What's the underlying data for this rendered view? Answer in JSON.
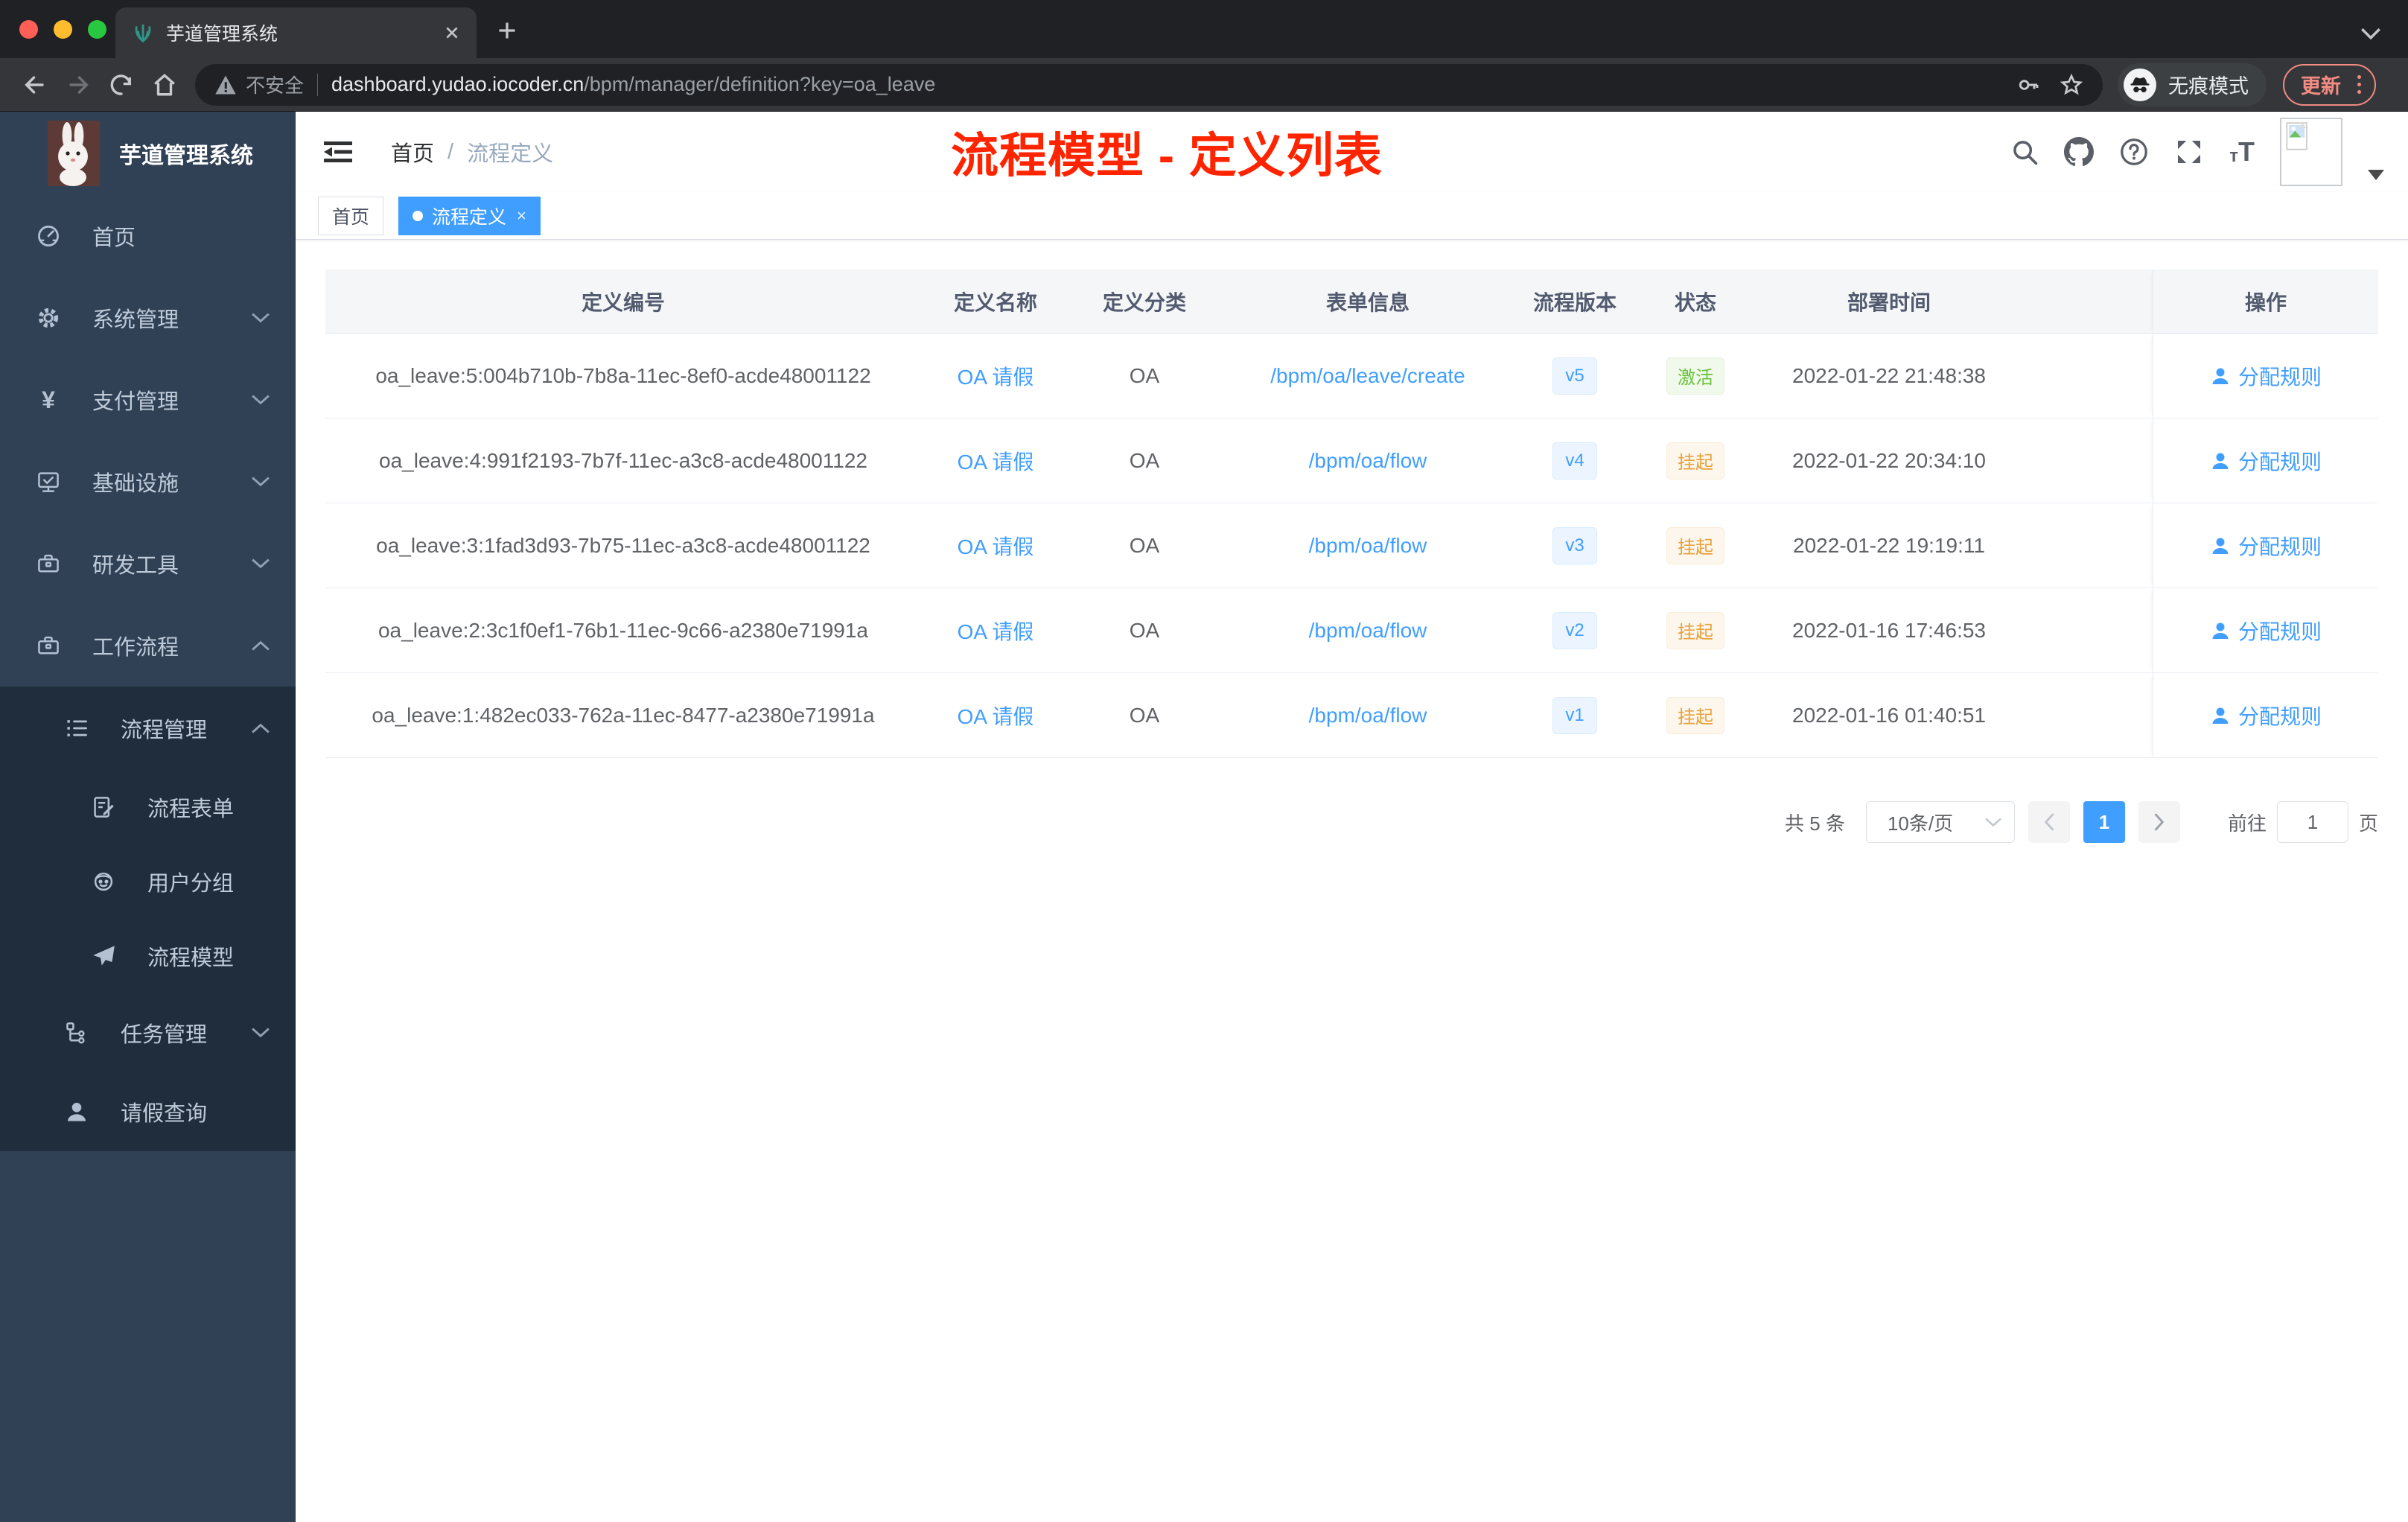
{
  "browser": {
    "tab_title": "芋道管理系统",
    "url": {
      "security": "不安全",
      "host": "dashboard.yudao.iocoder.cn",
      "path": "/bpm/manager/definition?key=oa_leave"
    },
    "incognito_label": "无痕模式",
    "update_label": "更新"
  },
  "sidebar": {
    "brand": "芋道管理系统",
    "items": [
      {
        "label": "首页"
      },
      {
        "label": "系统管理"
      },
      {
        "label": "支付管理"
      },
      {
        "label": "基础设施"
      },
      {
        "label": "研发工具"
      },
      {
        "label": "工作流程"
      }
    ],
    "submenu": [
      {
        "label": "流程管理"
      },
      {
        "label": "流程表单"
      },
      {
        "label": "用户分组"
      },
      {
        "label": "流程模型"
      },
      {
        "label": "任务管理"
      },
      {
        "label": "请假查询"
      }
    ]
  },
  "navbar": {
    "breadcrumb": {
      "home": "首页",
      "separator": "/",
      "current": "流程定义"
    },
    "annotation": "流程模型 - 定义列表"
  },
  "tags": [
    {
      "label": "首页"
    },
    {
      "label": "流程定义"
    }
  ],
  "table": {
    "headers": [
      "定义编号",
      "定义名称",
      "定义分类",
      "表单信息",
      "流程版本",
      "状态",
      "部署时间"
    ],
    "op_header": "操作",
    "op_label": "分配规则",
    "rows": [
      {
        "id": "oa_leave:5:004b710b-7b8a-11ec-8ef0-acde48001122",
        "name": "OA 请假",
        "category": "OA",
        "form": "/bpm/oa/leave/create",
        "version": "v5",
        "status": "激活",
        "status_type": "success",
        "deployed": "2022-01-22 21:48:38"
      },
      {
        "id": "oa_leave:4:991f2193-7b7f-11ec-a3c8-acde48001122",
        "name": "OA 请假",
        "category": "OA",
        "form": "/bpm/oa/flow",
        "version": "v4",
        "status": "挂起",
        "status_type": "warning",
        "deployed": "2022-01-22 20:34:10"
      },
      {
        "id": "oa_leave:3:1fad3d93-7b75-11ec-a3c8-acde48001122",
        "name": "OA 请假",
        "category": "OA",
        "form": "/bpm/oa/flow",
        "version": "v3",
        "status": "挂起",
        "status_type": "warning",
        "deployed": "2022-01-22 19:19:11"
      },
      {
        "id": "oa_leave:2:3c1f0ef1-76b1-11ec-9c66-a2380e71991a",
        "name": "OA 请假",
        "category": "OA",
        "form": "/bpm/oa/flow",
        "version": "v2",
        "status": "挂起",
        "status_type": "warning",
        "deployed": "2022-01-16 17:46:53"
      },
      {
        "id": "oa_leave:1:482ec033-762a-11ec-8477-a2380e71991a",
        "name": "OA 请假",
        "category": "OA",
        "form": "/bpm/oa/flow",
        "version": "v1",
        "status": "挂起",
        "status_type": "warning",
        "deployed": "2022-01-16 01:40:51"
      }
    ]
  },
  "pagination": {
    "total": "共 5 条",
    "page_size": "10条/页",
    "current": "1",
    "goto_label": "前往",
    "goto_value": "1",
    "unit": "页"
  }
}
